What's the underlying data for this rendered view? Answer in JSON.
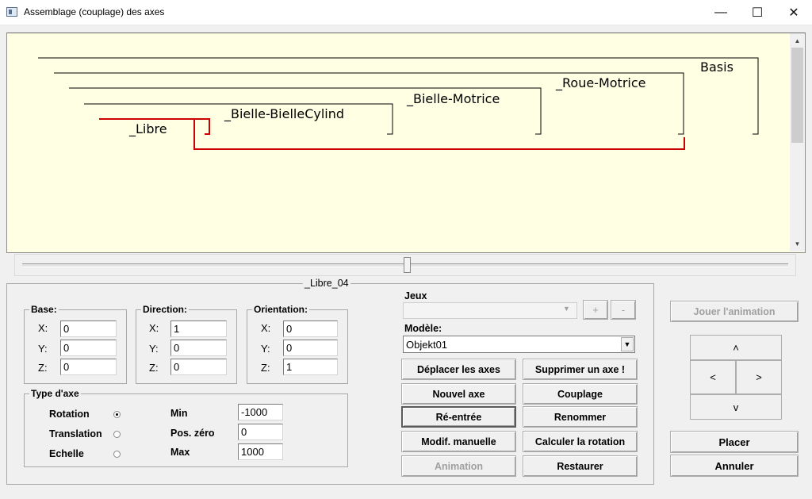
{
  "window": {
    "title": "Assemblage (couplage) des axes",
    "controls": {
      "minimize": "—",
      "maximize": "☐",
      "close": "✕"
    }
  },
  "tree": {
    "nodes": [
      "Basis",
      "_Roue-Motrice",
      "_Bielle-Motrice",
      "_Bielle-BielleCylind",
      "_Libre"
    ],
    "highlight_color": "#cc0000",
    "background": "#ffffe4"
  },
  "axis_group": {
    "title": "_Libre_04",
    "base": {
      "label": "Base:",
      "x_label": "X:",
      "y_label": "Y:",
      "z_label": "Z:",
      "x": "0",
      "y": "0",
      "z": "0"
    },
    "direction": {
      "label": "Direction:",
      "x_label": "X:",
      "y_label": "Y:",
      "z_label": "Z:",
      "x": "1",
      "y": "0",
      "z": "0"
    },
    "orientation": {
      "label": "Orientation:",
      "x_label": "X:",
      "y_label": "Y:",
      "z_label": "Z:",
      "x": "0",
      "y": "0",
      "z": "1"
    },
    "type": {
      "label": "Type d'axe",
      "options": [
        "Rotation",
        "Translation",
        "Echelle"
      ],
      "selected": "Rotation",
      "min_label": "Min",
      "min": "-1000",
      "zero_label": "Pos. zéro",
      "zero": "0",
      "max_label": "Max",
      "max": "1000"
    }
  },
  "jeux": {
    "label": "Jeux",
    "value": "",
    "plus": "+",
    "minus": "-"
  },
  "modele": {
    "label": "Modèle:",
    "value": "Objekt01"
  },
  "buttons": {
    "deplacer": "Déplacer les axes",
    "supprimer": "Supprimer un axe !",
    "nouvel": "Nouvel axe",
    "couplage": "Couplage",
    "reentree": "Ré-entrée",
    "renommer": "Renommer",
    "modif": "Modif. manuelle",
    "calculer": "Calculer la rotation",
    "animation": "Animation",
    "restaurer": "Restaurer",
    "jouer": "Jouer l'animation",
    "placer": "Placer",
    "annuler": "Annuler"
  },
  "nav": {
    "up": "˄",
    "left": "<",
    "right": ">",
    "down": "v"
  },
  "scroll": {
    "up": "▲",
    "down": "▼"
  }
}
